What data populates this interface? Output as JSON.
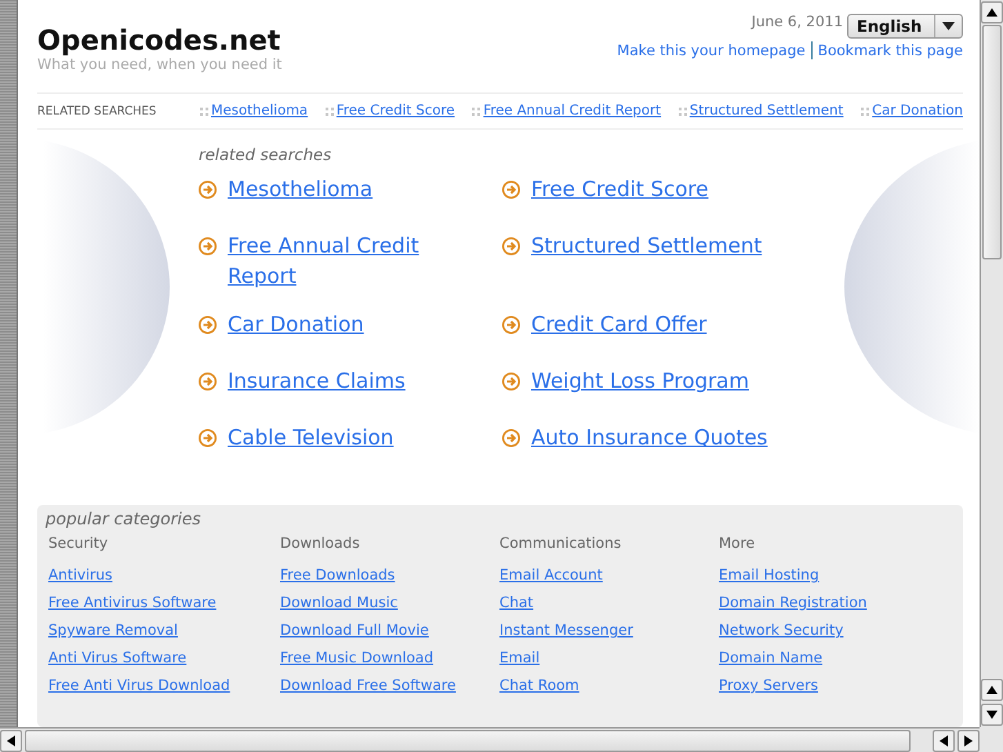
{
  "header": {
    "logo": "Openicodes.net",
    "tagline": "What you need, when you need it",
    "date": "June 6, 2011",
    "language": "English",
    "links": [
      "Make this your homepage",
      "Bookmark this page"
    ]
  },
  "related_bar": {
    "label": "RELATED SEARCHES",
    "links": [
      "Mesothelioma",
      "Free Credit Score",
      "Free Annual Credit Report",
      "Structured Settlement",
      "Car Donation"
    ]
  },
  "related_searches": {
    "title": "related searches",
    "links": [
      "Mesothelioma",
      "Free Credit Score",
      "Free Annual Credit Report",
      "Structured Settlement",
      "Car Donation",
      "Credit Card Offer",
      "Insurance Claims",
      "Weight Loss Program",
      "Cable Television",
      "Auto Insurance Quotes"
    ]
  },
  "popular_categories": {
    "title": "popular categories",
    "columns": [
      {
        "heading": "Security",
        "links": [
          "Antivirus",
          "Free Antivirus Software",
          "Spyware Removal",
          "Anti Virus Software",
          "Free Anti Virus Download"
        ]
      },
      {
        "heading": "Downloads",
        "links": [
          "Free Downloads",
          "Download Music",
          "Download Full Movie",
          "Free Music Download",
          "Download Free Software"
        ]
      },
      {
        "heading": "Communications",
        "links": [
          "Email Account",
          "Chat",
          "Instant Messenger",
          "Email",
          "Chat Room"
        ]
      },
      {
        "heading": "More",
        "links": [
          "Email Hosting",
          "Domain Registration",
          "Network Security",
          "Domain Name",
          "Proxy Servers"
        ]
      }
    ]
  }
}
